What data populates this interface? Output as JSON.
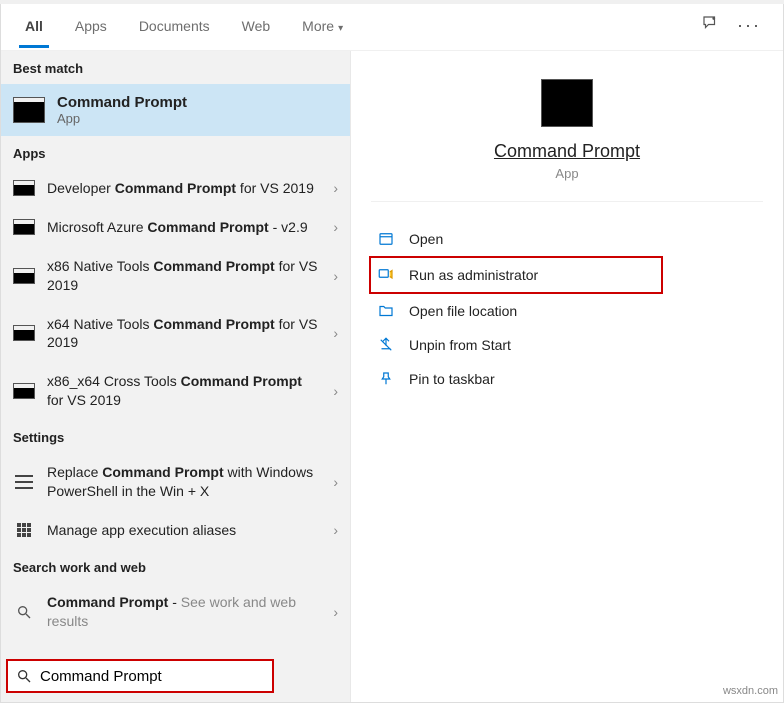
{
  "tabs": {
    "all": "All",
    "apps": "Apps",
    "documents": "Documents",
    "web": "Web",
    "more": "More"
  },
  "sections": {
    "best_match": "Best match",
    "apps": "Apps",
    "settings": "Settings",
    "search_ww": "Search work and web"
  },
  "best_match": {
    "title": "Command Prompt",
    "sub": "App"
  },
  "apps_list": [
    {
      "pre": "Developer ",
      "bold": "Command Prompt",
      "post": " for VS 2019"
    },
    {
      "pre": "Microsoft Azure ",
      "bold": "Command Prompt",
      "post": " - v2.9"
    },
    {
      "pre": "x86 Native Tools ",
      "bold": "Command Prompt",
      "post": " for VS 2019"
    },
    {
      "pre": "x64 Native Tools ",
      "bold": "Command Prompt",
      "post": " for VS 2019"
    },
    {
      "pre": "x86_x64 Cross Tools ",
      "bold": "Command Prompt",
      "post": " for VS 2019"
    }
  ],
  "settings_list": [
    {
      "pre": "Replace ",
      "bold": "Command Prompt",
      "post": " with Windows PowerShell in the Win + X"
    },
    {
      "pre": "Manage app execution aliases",
      "bold": "",
      "post": ""
    }
  ],
  "search_ww": {
    "pre": "",
    "bold": "Command Prompt",
    "post": " - ",
    "hint": "See work and web results"
  },
  "preview": {
    "title": "Command Prompt",
    "sub": "App"
  },
  "actions": {
    "open": "Open",
    "run_admin": "Run as administrator",
    "open_loc": "Open file location",
    "unpin": "Unpin from Start",
    "pin_tb": "Pin to taskbar"
  },
  "search": {
    "value": "Command Prompt"
  },
  "watermark": "wsxdn.com"
}
